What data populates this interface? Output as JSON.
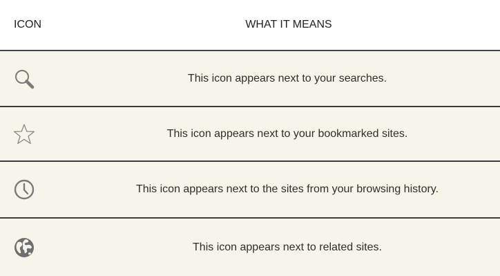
{
  "header": {
    "col_icon": "ICON",
    "col_meaning": "WHAT IT MEANS"
  },
  "rows": [
    {
      "icon": "search-icon",
      "text": "This icon appears next to your searches."
    },
    {
      "icon": "star-icon",
      "text": "This icon appears next to your bookmarked sites."
    },
    {
      "icon": "clock-icon",
      "text": "This icon appears next to the sites from your browsing history."
    },
    {
      "icon": "globe-icon",
      "text": "This icon appears next to related sites."
    }
  ],
  "colors": {
    "row_background": "#f7f4ea",
    "divider": "#3a3a3a",
    "icon_gray": "#7a7a7a"
  }
}
